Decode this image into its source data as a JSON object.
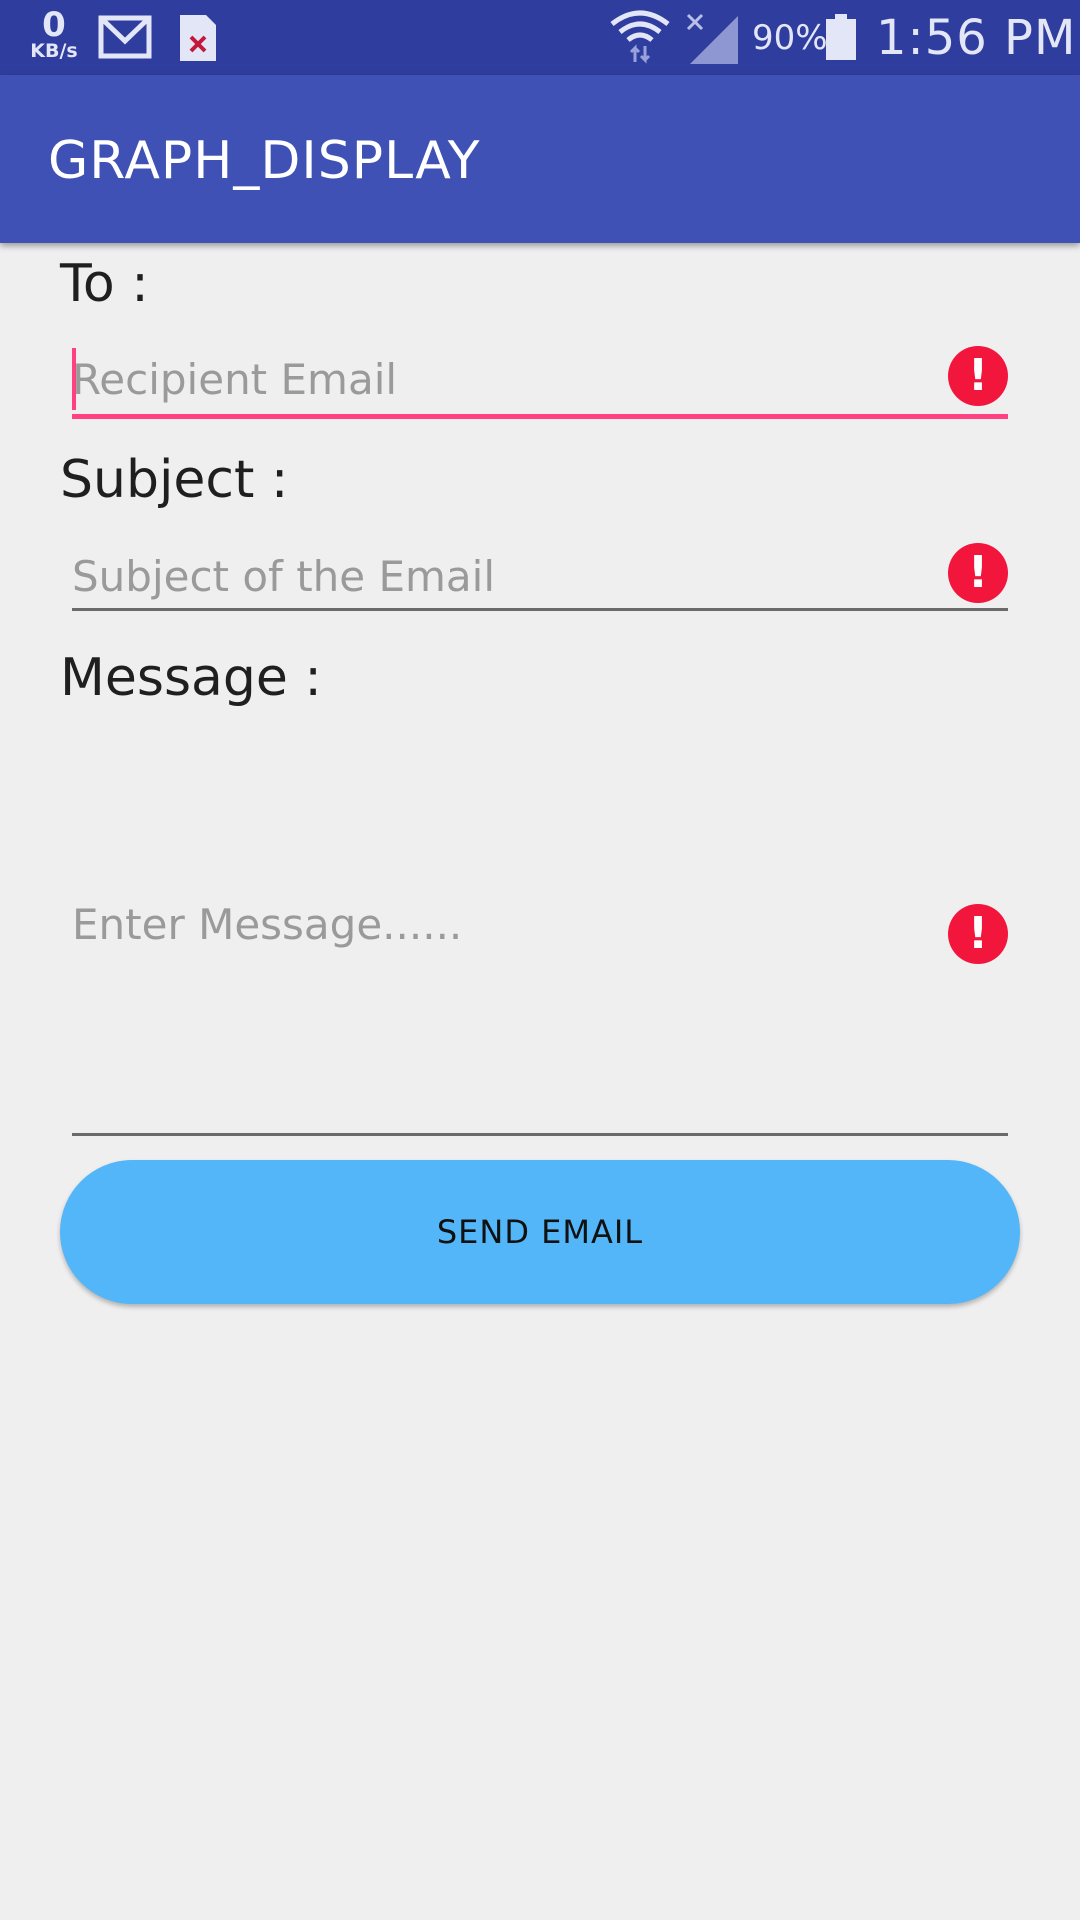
{
  "status_bar": {
    "net_speed_value": "0",
    "net_speed_unit": "KB/s",
    "notification_icons": [
      "gmail-icon",
      "sim-error-icon"
    ],
    "battery_percent": "90%",
    "time": "1:56 PM",
    "background_color": "#2f3d9e"
  },
  "app_bar": {
    "title": "GRAPH_DISPLAY",
    "background_color": "#3f51b5"
  },
  "form": {
    "to_label": "To :",
    "to_placeholder": "Recipient Email",
    "subject_label": "Subject :",
    "subject_placeholder": "Subject of the Email",
    "message_label": "Message :",
    "message_placeholder": "Enter Message......",
    "error_icon_symbol": "!",
    "error_color": "#f2163c",
    "focus_color": "#ff4081"
  },
  "button": {
    "send_label": "SEND EMAIL",
    "background_color": "#52b6f8"
  }
}
